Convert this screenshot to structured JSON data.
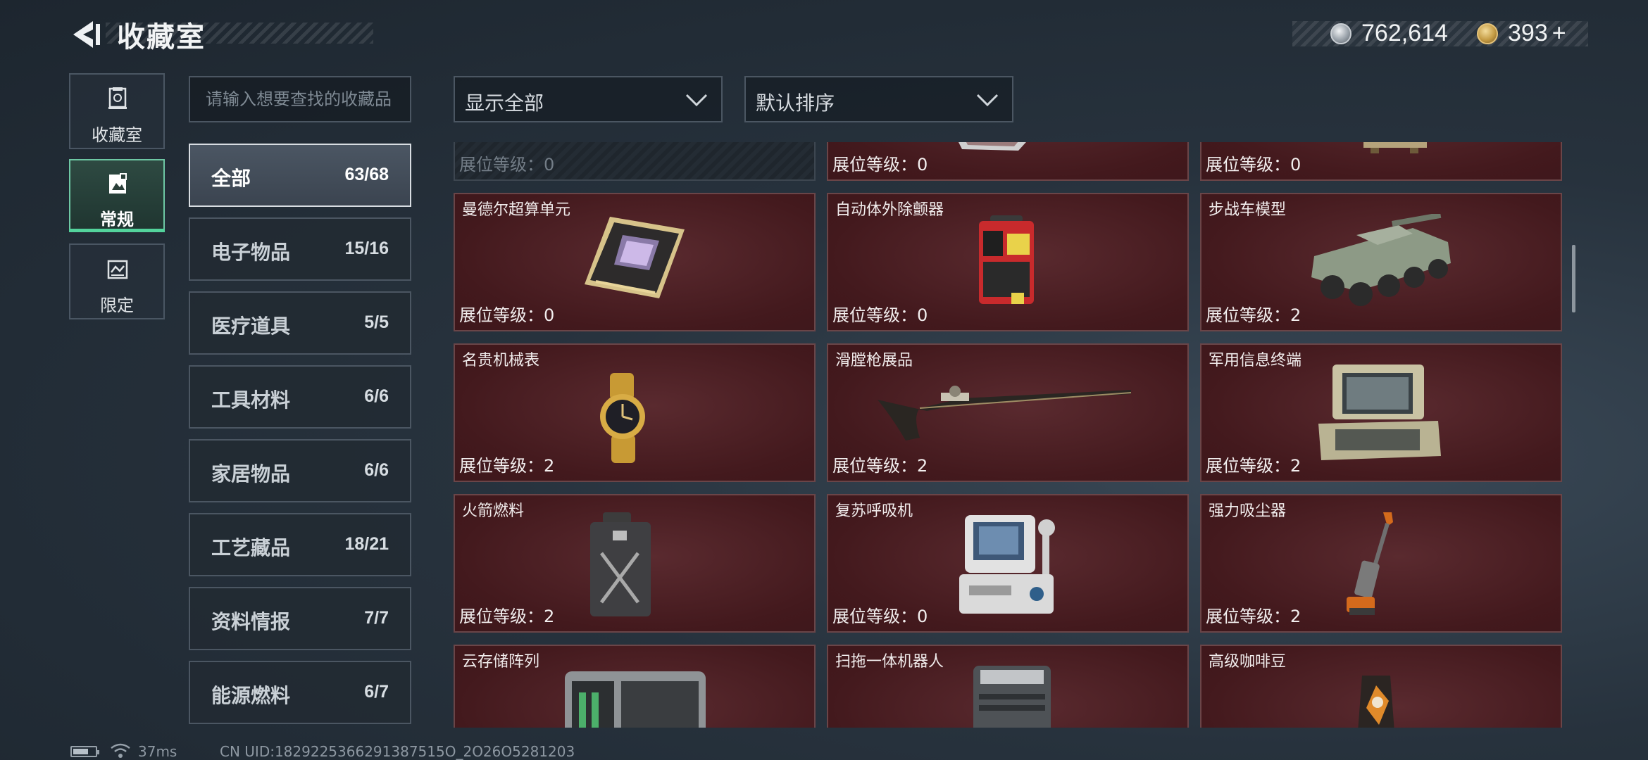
{
  "header": {
    "title": "收藏室",
    "currency": {
      "silver": "762,614",
      "gold": "393",
      "gold_plus": "+"
    }
  },
  "modes": [
    {
      "label": "收藏室",
      "icon": "collection-room-icon",
      "active": false
    },
    {
      "label": "常规",
      "icon": "regular-icon",
      "active": true
    },
    {
      "label": "限定",
      "icon": "limited-icon",
      "active": false
    }
  ],
  "search": {
    "placeholder": "请输入想要查找的收藏品"
  },
  "filters": {
    "display": "显示全部",
    "sort": "默认排序"
  },
  "categories": [
    {
      "name": "全部",
      "count": "63/68",
      "active": true
    },
    {
      "name": "电子物品",
      "count": "15/16"
    },
    {
      "name": "医疗道具",
      "count": "5/5"
    },
    {
      "name": "工具材料",
      "count": "6/6"
    },
    {
      "name": "家居物品",
      "count": "6/6"
    },
    {
      "name": "工艺藏品",
      "count": "18/21"
    },
    {
      "name": "资料情报",
      "count": "7/7"
    },
    {
      "name": "能源燃料",
      "count": "6/7"
    }
  ],
  "items": [
    {
      "name": "",
      "level": "展位等级：0",
      "locked": true
    },
    {
      "name": "",
      "level": "展位等级：0"
    },
    {
      "name": "",
      "level": "展位等级：0"
    },
    {
      "name": "曼德尔超算单元",
      "level": "展位等级：0"
    },
    {
      "name": "自动体外除颤器",
      "level": "展位等级：0"
    },
    {
      "name": "步战车模型",
      "level": "展位等级：2"
    },
    {
      "name": "名贵机械表",
      "level": "展位等级：2"
    },
    {
      "name": "滑膛枪展品",
      "level": "展位等级：2"
    },
    {
      "name": "军用信息终端",
      "level": "展位等级：2"
    },
    {
      "name": "火箭燃料",
      "level": "展位等级：2"
    },
    {
      "name": "复苏呼吸机",
      "level": "展位等级：0"
    },
    {
      "name": "强力吸尘器",
      "level": "展位等级：2"
    },
    {
      "name": "云存储阵列",
      "level": ""
    },
    {
      "name": "扫拖一体机器人",
      "level": ""
    },
    {
      "name": "高级咖啡豆",
      "level": ""
    }
  ],
  "status": {
    "ping": "37ms",
    "uid": "CN UID:1829225366291387515O_2O26O5281203",
    "battery_level": 0.7
  }
}
